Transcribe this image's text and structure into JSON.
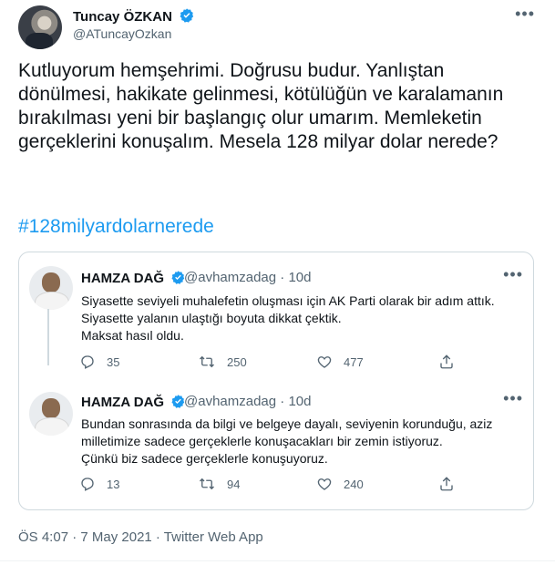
{
  "author": {
    "name": "Tuncay ÖZKAN",
    "handle": "@ATuncayOzkan"
  },
  "tweet": {
    "text": "Kutluyorum hemşehrimi. Doğrusu budur. Yanlıştan dönülmesi, hakikate gelinmesi, kötülüğün ve karalamanın bırakılması yeni bir başlangıç olur umarım. Memleketin gerçeklerini konuşalım. Mesela 128 milyar dolar nerede?",
    "hashtag": "#128milyardolarnerede"
  },
  "quoted_thread": [
    {
      "name": "HAMZA DAĞ",
      "handle": "@avhamzadag",
      "time": "· 10d",
      "lines": [
        "Siyasette seviyeli muhalefetin oluşması için AK Parti olarak bir adım attık.",
        "Siyasette yalanın ulaştığı boyuta dikkat çektik.",
        "Maksat hasıl oldu."
      ],
      "replies": "35",
      "retweets": "250",
      "likes": "477"
    },
    {
      "name": "HAMZA DAĞ",
      "handle": "@avhamzadag",
      "time": "· 10d",
      "lines": [
        "Bundan sonrasında da bilgi ve belgeye dayalı, seviyenin korunduğu, aziz",
        "milletimize sadece gerçeklerle konuşacakları bir zemin istiyoruz.",
        "Çünkü biz sadece gerçeklerle konuşuyoruz."
      ],
      "replies": "13",
      "retweets": "94",
      "likes": "240"
    }
  ],
  "meta": "ÖS 4:07 · 7 May 2021 · Twitter Web App",
  "colors": {
    "accent": "#1d9bf0",
    "muted": "#536471",
    "border": "#cfd9de"
  },
  "icons": [
    "verified-badge-icon",
    "more-icon",
    "reply-icon",
    "retweet-icon",
    "like-icon",
    "share-icon"
  ]
}
